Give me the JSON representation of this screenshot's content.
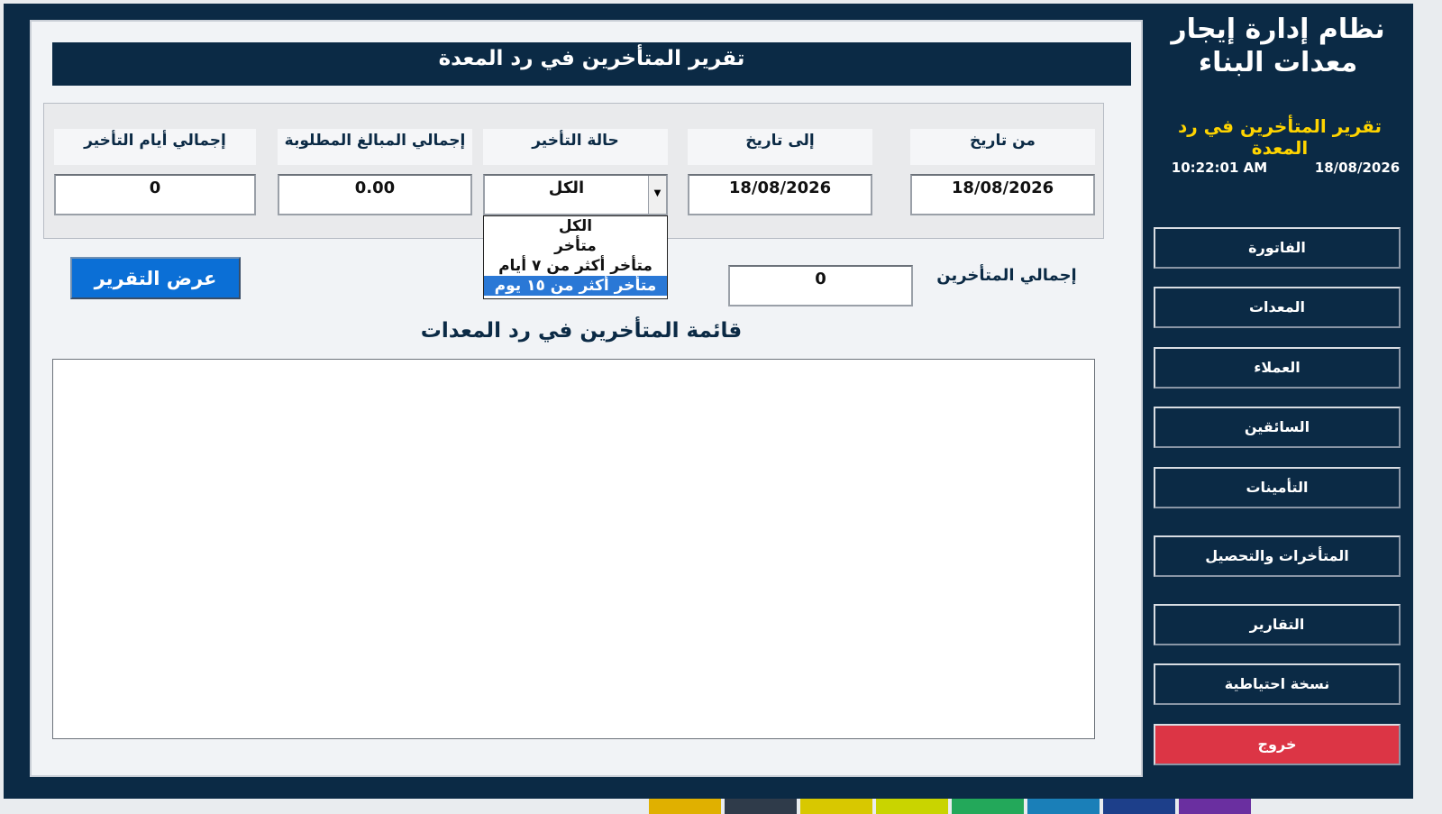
{
  "app": {
    "title": "نظام إدارة إيجار معدات البناء",
    "report_title": "تقرير المتأخرين في رد المعدة",
    "date": "18/08/2026",
    "time": "10:22:01 AM"
  },
  "form": {
    "header": "تقرير المتأخرين في رد المعدة",
    "from_date_label": "من تاريخ",
    "from_date_value": "18/08/2026",
    "to_date_label": "إلى تاريخ",
    "to_date_value": "18/08/2026",
    "status_label": "حالة التأخير",
    "status_value": "الكل",
    "total_amount_label": "إجمالي المبالغ المطلوبة",
    "total_amount_value": "0.00",
    "total_days_label": "إجمالي أيام التأخير",
    "total_days_value": "0",
    "status_options": [
      "الكل",
      "متأخر",
      "متأخر أكثر من ٧ أيام",
      "متأخر أكثر من ١٥ يوم"
    ],
    "status_highlighted_option": "متأخر أكثر من ١٥ يوم",
    "show_report_label": "عرض التقرير",
    "total_late_label": "إجمالي المتأخرين",
    "total_late_value": "0",
    "list_title": "قائمة المتأخرين في رد المعدات"
  },
  "nav": {
    "invoice": "الفاتورة",
    "equipment": "المعدات",
    "customers": "العملاء",
    "drivers": "السائقين",
    "insurance": "التأمينات",
    "late_collection": "المتأخرات والتحصيل",
    "reports": "التقارير",
    "backup": "نسخة احتياطية",
    "exit": "خروج"
  },
  "colors": {
    "brand_navy": "#0b2a45",
    "accent_yellow": "#ffd400",
    "button_blue": "#0b6fd6",
    "exit_red": "#dc3545",
    "selection_blue": "#2a78d6"
  }
}
